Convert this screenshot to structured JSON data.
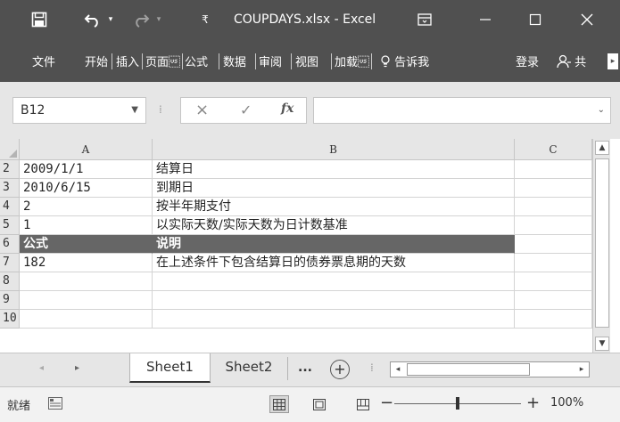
{
  "window": {
    "title": "COUPDAYS.xlsx - Excel",
    "quick_access": [
      "save-icon",
      "undo-icon",
      "redo-icon",
      "customize-icon"
    ],
    "controls": [
      "ribbon-display-icon",
      "minimize-icon",
      "maximize-icon",
      "close-icon"
    ]
  },
  "ribbon": {
    "tabs": [
      "文件",
      "开始",
      "插入",
      "页面\u001f",
      "公式",
      "数据",
      "审阅",
      "视图",
      "加载\u001f"
    ],
    "tell_me": "告诉我",
    "login": "登录",
    "share": "共"
  },
  "formula_bar": {
    "name_box": "B12",
    "fx_label": "fx",
    "formula": ""
  },
  "grid": {
    "columns": [
      "A",
      "B",
      "C"
    ],
    "rows": [
      {
        "num": "2",
        "a": "2009/1/1",
        "b": "结算日",
        "c": "",
        "header": false
      },
      {
        "num": "3",
        "a": "2010/6/15",
        "b": "到期日",
        "c": "",
        "header": false
      },
      {
        "num": "4",
        "a": "2",
        "b": "按半年期支付",
        "c": "",
        "header": false
      },
      {
        "num": "5",
        "a": "1",
        "b": "以实际天数/实际天数为日计数基准",
        "c": "",
        "header": false
      },
      {
        "num": "6",
        "a": "公式",
        "b": "说明",
        "c": "",
        "header": true
      },
      {
        "num": "7",
        "a": "182",
        "b": "在上述条件下包含结算日的债券票息期的天数",
        "c": "",
        "header": false
      },
      {
        "num": "8",
        "a": "",
        "b": "",
        "c": "",
        "header": false
      },
      {
        "num": "9",
        "a": "",
        "b": "",
        "c": "",
        "header": false
      },
      {
        "num": "10",
        "a": "",
        "b": "",
        "c": "",
        "header": false
      }
    ]
  },
  "sheets": {
    "tabs": [
      "Sheet1",
      "Sheet2"
    ],
    "active": "Sheet1",
    "more": "...",
    "add": "+"
  },
  "status": {
    "text": "就绪",
    "zoom": "100%",
    "zoom_level": 0.5
  },
  "colors": {
    "titlebar": "#505050",
    "header_row": "#666666",
    "chrome": "#e6e6e6"
  }
}
